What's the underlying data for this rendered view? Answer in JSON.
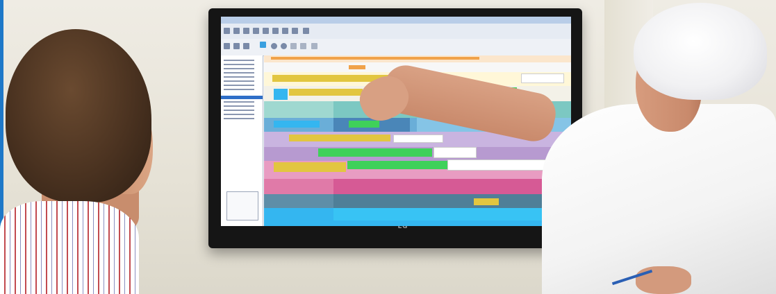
{
  "tv": {
    "brand": "LG"
  },
  "colors": {
    "bar_yellow": "#e2c640",
    "bar_green": "#3fd15a",
    "bar_blue": "#34b6f0",
    "bar_pink": "#e07aa8",
    "bar_teal": "#6fc6c4",
    "bar_purple": "#a57bc9",
    "bar_orange": "#f0a24a",
    "frame": "#151515"
  }
}
